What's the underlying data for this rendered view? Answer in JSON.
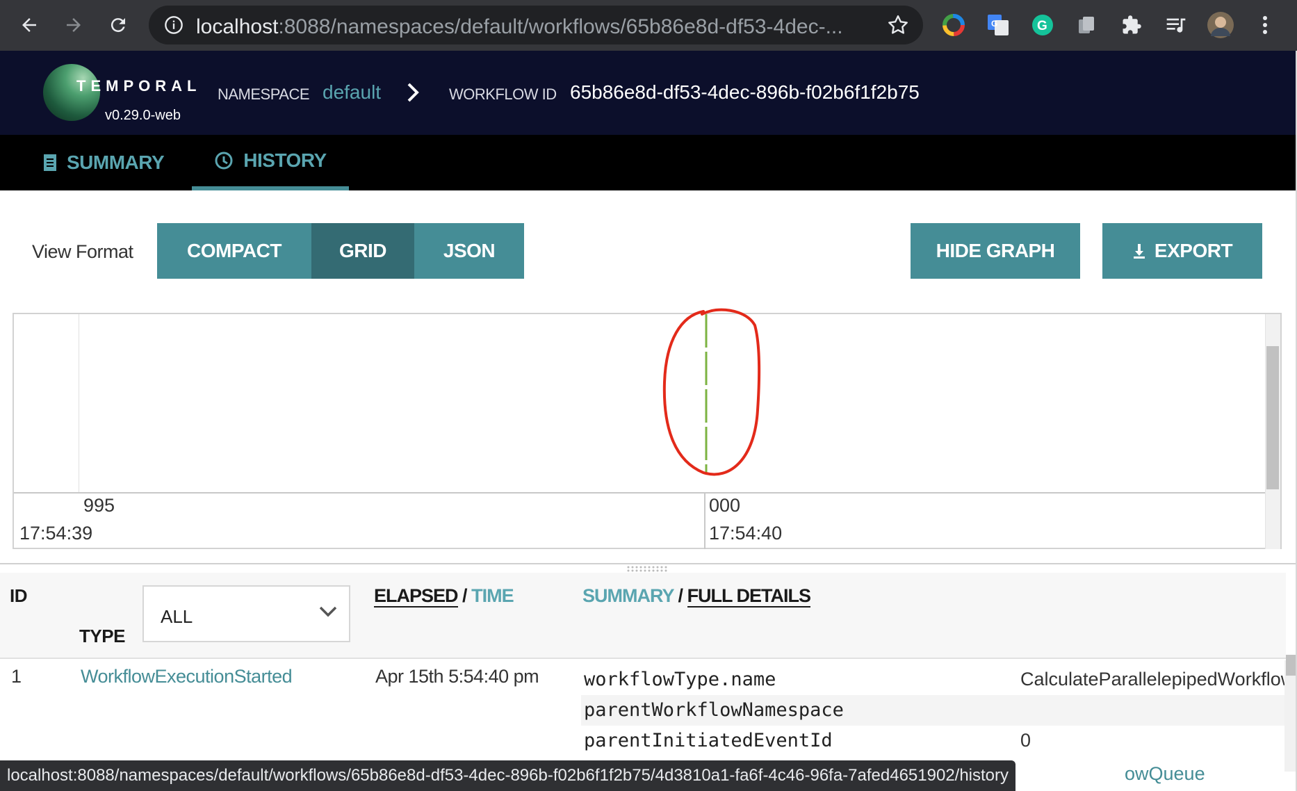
{
  "browser": {
    "url_host": "localhost",
    "url_rest": ":8088/namespaces/default/workflows/65b86e8d-df53-4dec-...",
    "icons": [
      "back-icon",
      "forward-icon",
      "reload-icon",
      "info-icon",
      "star-icon",
      "color-wheel-icon",
      "translate-icon",
      "grammarly-icon",
      "copy-icon",
      "puzzle-icon",
      "media-queue-icon",
      "profile-avatar",
      "kebab-menu-icon"
    ]
  },
  "header": {
    "logo": "TEMPORAL",
    "version": "v0.29.0-web",
    "namespace_label": "NAMESPACE",
    "namespace_value": "default",
    "workflow_label": "WORKFLOW ID",
    "workflow_id": "65b86e8d-df53-4dec-896b-f02b6f1f2b75"
  },
  "tabs": [
    {
      "label": "SUMMARY",
      "icon": "document-icon",
      "active": false
    },
    {
      "label": "HISTORY",
      "icon": "history-icon",
      "active": true
    }
  ],
  "view_format": {
    "label": "View Format",
    "options": [
      "COMPACT",
      "GRID",
      "JSON"
    ],
    "selected": "GRID"
  },
  "actions": {
    "hide_graph": "HIDE GRAPH",
    "export": "EXPORT"
  },
  "graph": {
    "ticks": [
      {
        "ms": "995",
        "time": "17:54:39"
      },
      {
        "ms": "000",
        "time": "17:54:40"
      }
    ],
    "event_color": "#7cb342",
    "annotation_color": "#e32a1a"
  },
  "table": {
    "col_id": "ID",
    "col_type": "TYPE",
    "type_filter": "ALL",
    "elapsed": "ELAPSED",
    "time": "TIME",
    "summary": "SUMMARY",
    "full_details": "FULL DETAILS",
    "slash": "/"
  },
  "events": [
    {
      "id": "1",
      "type": "WorkflowExecutionStarted",
      "time": "Apr 15th 5:54:40 pm",
      "details": [
        {
          "key": "workflowType.name",
          "value": "CalculateParallelepipedWorkflow"
        },
        {
          "key": "parentWorkflowNamespace",
          "value": ""
        },
        {
          "key": "parentInitiatedEventId",
          "value": "0"
        }
      ]
    }
  ],
  "status_bar": {
    "link": "localhost:8088/namespaces/default/workflows/65b86e8d-df53-4dec-896b-f02b6f1f2b75/4d3810a1-fa6f-4c46-96fa-7afed4651902/history",
    "under_text": "owQueue"
  },
  "colors": {
    "teal": "#458d96",
    "teal_dark": "#346b73",
    "header_bg": "#0c0f2b"
  }
}
